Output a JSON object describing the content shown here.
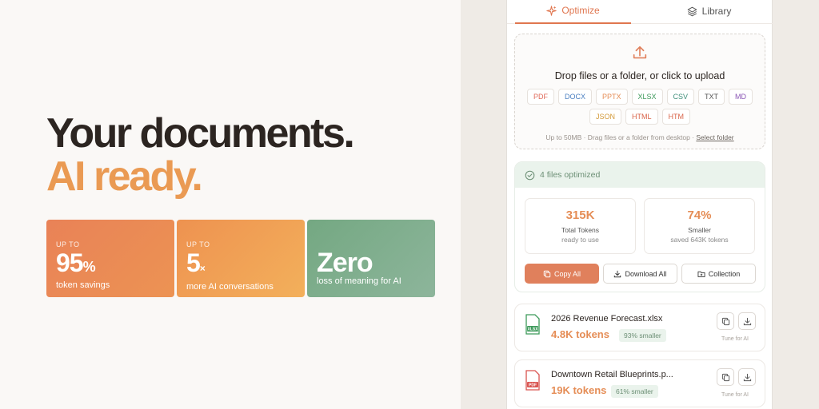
{
  "hero": {
    "line1": "Your documents.",
    "line2": "AI ready.",
    "colors": {
      "dark": "#2c2521",
      "accent": "#ea9a53"
    }
  },
  "stats": [
    {
      "prefix": "UP TO",
      "value": "95",
      "unit": "%",
      "label": "token savings"
    },
    {
      "prefix": "UP TO",
      "value": "5",
      "unit": "×",
      "label": "more AI conversations"
    },
    {
      "prefix": "",
      "value": "Zero",
      "unit": "",
      "label": "loss of meaning for AI"
    }
  ],
  "tabs": [
    {
      "label": "Optimize",
      "icon": "sparkle-icon",
      "active": true
    },
    {
      "label": "Library",
      "icon": "layers-icon",
      "active": false
    }
  ],
  "upload": {
    "title": "Drop files or a folder, or click to upload",
    "formats_row1": [
      "PDF",
      "DOCX",
      "PPTX",
      "XLSX",
      "CSV",
      "TXT",
      "MD"
    ],
    "formats_row2": [
      "JSON",
      "HTML",
      "HTM"
    ],
    "note": "Up to 50MB · Drag files or a folder from desktop ·",
    "select_folder": "Select folder"
  },
  "summary": {
    "status": "4 files optimized",
    "metrics": [
      {
        "value": "315K",
        "label": "Total Tokens",
        "detail": "ready to use"
      },
      {
        "value": "74%",
        "label": "Smaller",
        "detail": "saved 643K tokens"
      }
    ],
    "buttons": {
      "copy_all": "Copy All",
      "download_all": "Download All",
      "collection": "Collection"
    }
  },
  "files": [
    {
      "name": "2026 Revenue Forecast.xlsx",
      "tokens": "4.8K tokens",
      "badge": "93% smaller",
      "type": "XLSX",
      "tune": "Tune for AI"
    },
    {
      "name": "Downtown Retail Blueprints.p...",
      "tokens": "19K tokens",
      "badge": "61% smaller",
      "type": "PDF",
      "tune": "Tune for AI"
    }
  ],
  "colors": {
    "orange": "#e0805c",
    "green_bg": "#eaf3ec",
    "green_text": "#6c8f75"
  }
}
